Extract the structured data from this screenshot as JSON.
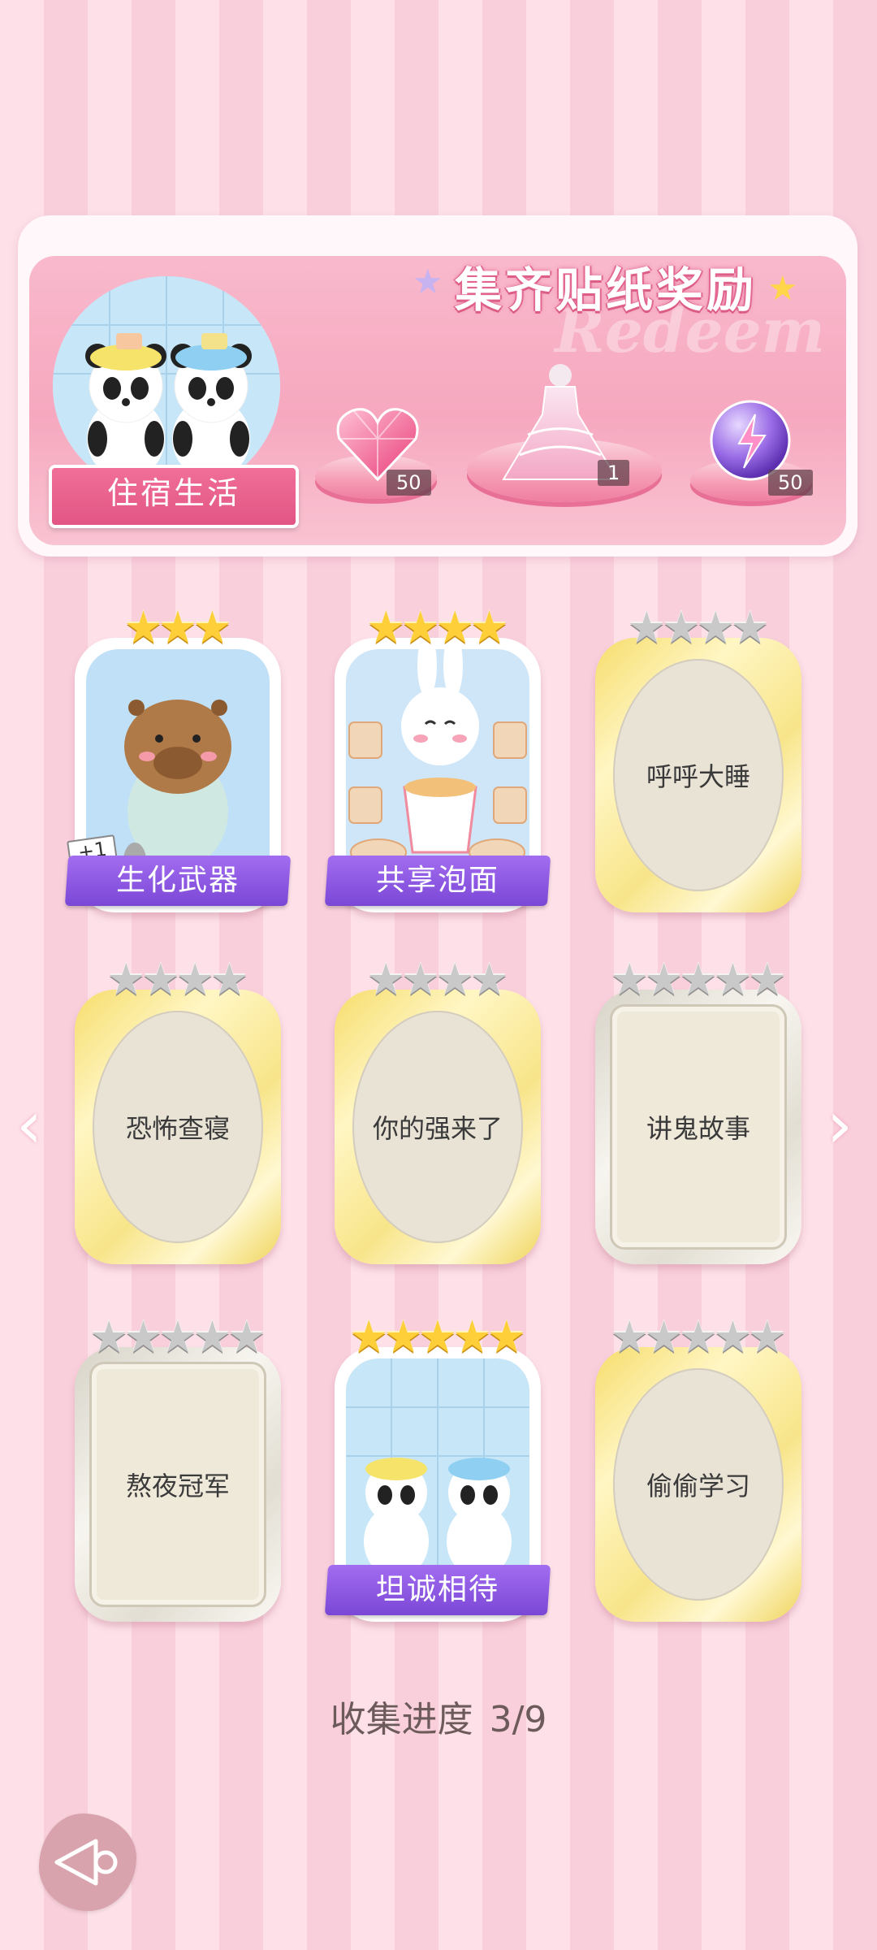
{
  "banner": {
    "title": "集齐贴纸奖励",
    "watermark": "Redeem",
    "category_label": "住宿生活",
    "rewards": [
      {
        "name": "pink-diamond-heart",
        "count": "50"
      },
      {
        "name": "dress-outfit",
        "count": "1"
      },
      {
        "name": "energy-orb",
        "count": "50"
      }
    ]
  },
  "cards": [
    {
      "name": "生化武器",
      "stars": 3,
      "max_stars": 3,
      "state": "collected",
      "badge": "+1"
    },
    {
      "name": "共享泡面",
      "stars": 4,
      "max_stars": 4,
      "state": "collected"
    },
    {
      "name": "呼呼大睡",
      "stars": 0,
      "max_stars": 4,
      "state": "locked"
    },
    {
      "name": "恐怖查寝",
      "stars": 0,
      "max_stars": 4,
      "state": "locked"
    },
    {
      "name": "你的强来了",
      "stars": 0,
      "max_stars": 4,
      "state": "locked"
    },
    {
      "name": "讲鬼故事",
      "stars": 0,
      "max_stars": 5,
      "state": "locked"
    },
    {
      "name": "熬夜冠军",
      "stars": 0,
      "max_stars": 5,
      "state": "locked"
    },
    {
      "name": "坦诚相待",
      "stars": 5,
      "max_stars": 5,
      "state": "collected"
    },
    {
      "name": "偷偷学习",
      "stars": 0,
      "max_stars": 5,
      "state": "locked"
    }
  ],
  "progress": {
    "label": "收集进度",
    "value": "3/9"
  },
  "colors": {
    "gold_star": "#ffcf3a",
    "name_band": "#8a57e0",
    "accent_pink": "#e25584"
  }
}
